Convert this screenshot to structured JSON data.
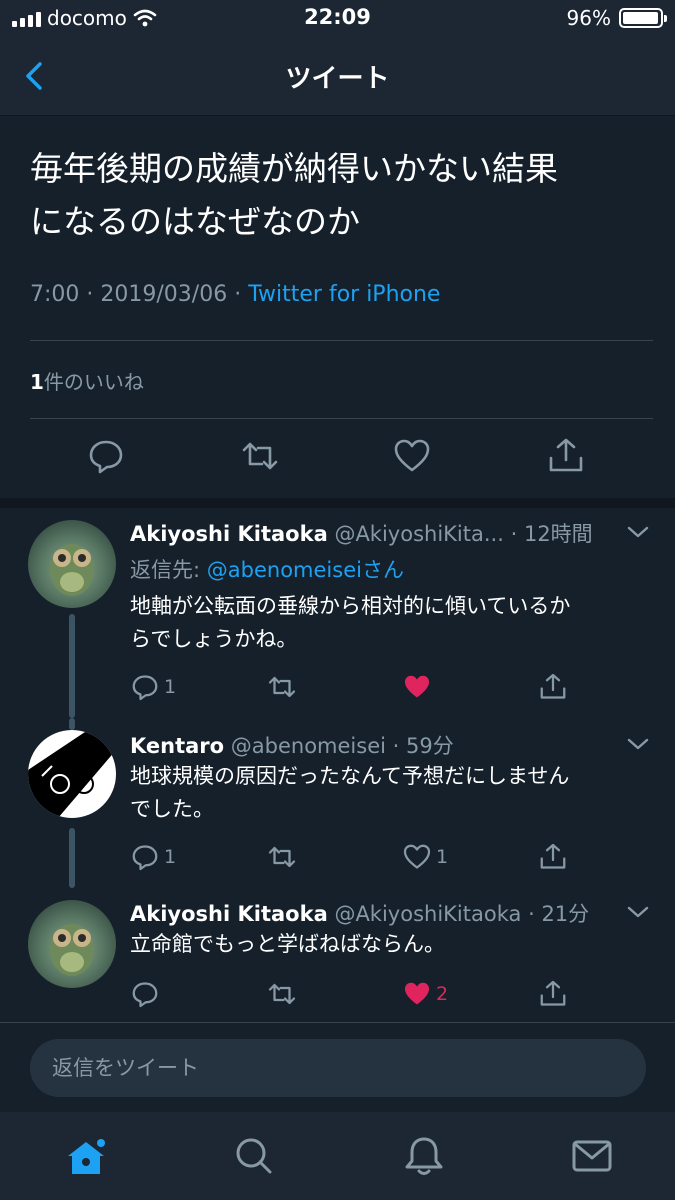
{
  "status_bar": {
    "carrier": "docomo",
    "time": "22:09",
    "battery": "96%",
    "battery_level": 0.96
  },
  "nav": {
    "title": "ツイート"
  },
  "main_tweet": {
    "text_line1": "毎年後期の成績が納得いかない結果",
    "text_line2": "になるのはなぜなのか",
    "time": "7:00",
    "date": "2019/03/06",
    "source": "Twitter for iPhone",
    "like_count": "1",
    "like_label": "件のいいね"
  },
  "replies": [
    {
      "name": "Akiyoshi Kitaoka",
      "handle": "@AkiyoshiKita...",
      "time": "12時間",
      "reply_to_label": "返信先: ",
      "reply_to_mention": "@abenomeiseiさん",
      "body_line1": "地軸が公転面の垂線から相対的に傾いているか",
      "body_line2": "らでしょうかね。",
      "reply_count": "1",
      "like_count": "",
      "liked": true
    },
    {
      "name": "Kentaro",
      "handle": "@abenomeisei",
      "time": "59分",
      "body_line1": "地球規模の原因だったなんて予想だにしません",
      "body_line2": "でした。",
      "reply_count": "1",
      "like_count": "1",
      "liked": false
    },
    {
      "name": "Akiyoshi Kitaoka",
      "handle": "@AkiyoshiKitaoka",
      "time": "21分",
      "body_line1": "立命館でもっと学ばねばならん。",
      "reply_count": "",
      "like_count": "2",
      "liked": true
    }
  ],
  "compose": {
    "placeholder": "返信をツイート"
  },
  "colors": {
    "background": "#15202b",
    "accent": "#1da1f2",
    "like": "#e0245e",
    "muted": "#8899a6"
  },
  "icons": {
    "tabs": [
      "home-icon",
      "search-icon",
      "notifications-icon",
      "messages-icon"
    ]
  }
}
